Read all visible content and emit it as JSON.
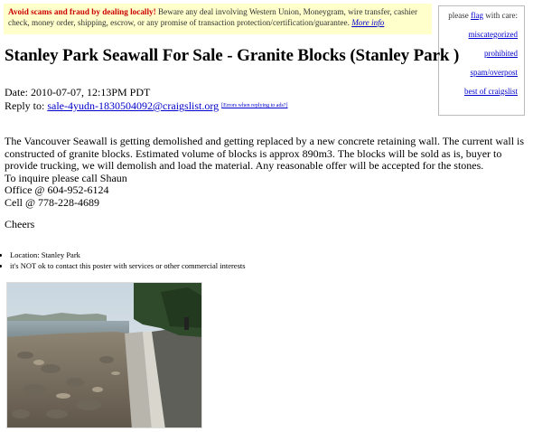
{
  "scam_warning": {
    "bold": "Avoid scams and fraud by dealing locally!",
    "text": " Beware any deal involving Western Union, Moneygram, wire transfer, cashier check, money order, shipping, escrow, or any promise of transaction protection/certification/guarantee. ",
    "more_info": "More info"
  },
  "flag": {
    "prefix": "please ",
    "link": "flag",
    "suffix": " with care:",
    "options": [
      "miscategorized",
      "prohibited",
      "spam/overpost",
      "best of craigslist"
    ]
  },
  "posting": {
    "title": "Stanley Park Seawall For Sale - Granite Blocks (Stanley Park )",
    "date": "Date: 2010-07-07, 12:13PM PDT",
    "reply_label": "Reply to: ",
    "reply_email": "sale-4yudn-1830504092@craigslist.org",
    "reply_errors": "[Errors when replying to ads?]",
    "body_lines": [
      "The Vancouver Seawall is getting demolished and getting replaced by a new concrete retaining wall. The current wall is constructed of granite blocks. Estimated volume of blocks is approx 890m3. The blocks will be sold as is, buyer to provide trucking, we will demolish and load the material. Any reasonable offer will be accepted for the stones.",
      "To inquire please call Shaun",
      "Office @ 604-952-6124",
      "Cell @ 778-228-4689"
    ],
    "signoff": "Cheers",
    "bullets": [
      "Location: Stanley Park",
      "it's NOT ok to contact this poster with services or other commercial interests"
    ]
  },
  "colors": {
    "link": "#0000cc",
    "warning_red": "#cc0000",
    "warning_bg": "#ffffcc"
  }
}
